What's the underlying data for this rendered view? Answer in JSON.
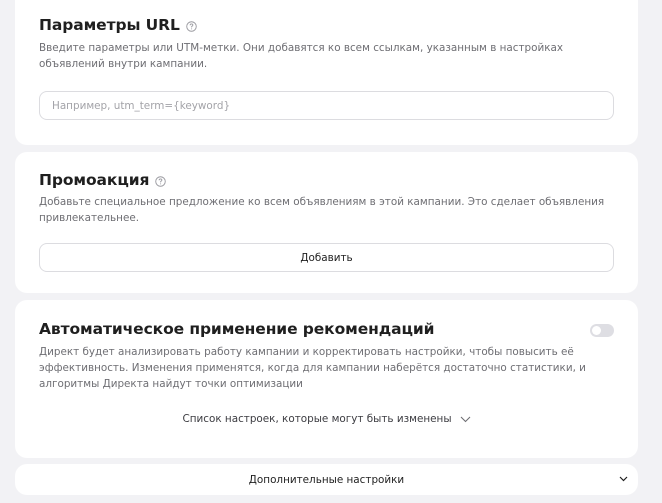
{
  "url_params": {
    "title": "Параметры URL",
    "description": "Введите параметры или UTM-метки. Они добавятся ко всем ссылкам, указанным в настройках объявлений внутри кампании.",
    "input_value": "",
    "input_placeholder": "Например, utm_term={keyword}"
  },
  "promo": {
    "title": "Промоакция",
    "description": "Добавьте специальное предложение ко всем объявлениям в этой кампании. Это сделает объявления привлекательнее.",
    "add_label": "Добавить"
  },
  "auto_recommendations": {
    "title": "Автоматическое применение рекомендаций",
    "toggle_on": false,
    "description": "Директ будет анализировать работу кампании и корректировать настройки, чтобы повысить её эффективность. Изменения применятся, когда для кампании наберётся достаточно статистики, и алгоритмы Директа найдут точки оптимизации",
    "settings_link": "Список настроек, которые могут быть изменены"
  },
  "extra": {
    "label": "Дополнительные настройки"
  },
  "icons": {
    "help": "question-circle-icon",
    "chevron": "chevron-down-icon"
  },
  "colors": {
    "background": "#f2f2f5",
    "card": "#ffffff",
    "text": "#1f1f1f",
    "muted": "#6e6e73",
    "border": "#dcdce0"
  }
}
